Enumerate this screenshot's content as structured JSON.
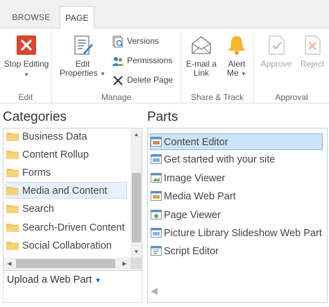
{
  "tabs": {
    "browse": "BROWSE",
    "page": "PAGE"
  },
  "ribbon": {
    "edit_group": {
      "label": "Edit",
      "stop_editing": "Stop Editing"
    },
    "manage_group": {
      "label": "Manage",
      "edit_properties_line1": "Edit",
      "edit_properties_line2": "Properties",
      "versions": "Versions",
      "permissions": "Permissions",
      "delete_page": "Delete Page"
    },
    "share_group": {
      "label": "Share & Track",
      "email_line1": "E-mail a",
      "email_line2": "Link",
      "alert_line1": "Alert",
      "alert_line2": "Me"
    },
    "approval_group": {
      "label": "Approval",
      "approve": "Approve",
      "reject": "Reject"
    }
  },
  "categories": {
    "heading": "Categories",
    "items": [
      "Business Data",
      "Content Rollup",
      "Forms",
      "Media and Content",
      "Search",
      "Search-Driven Content",
      "Social Collaboration"
    ],
    "selected_index": 3,
    "upload_label": "Upload a Web Part"
  },
  "parts": {
    "heading": "Parts",
    "items": [
      {
        "label": "Content Editor",
        "icon": "content-editor-icon"
      },
      {
        "label": "Get started with your site",
        "icon": "get-started-icon"
      },
      {
        "label": "Image Viewer",
        "icon": "image-viewer-icon"
      },
      {
        "label": "Media Web Part",
        "icon": "media-web-part-icon"
      },
      {
        "label": "Page Viewer",
        "icon": "page-viewer-icon"
      },
      {
        "label": "Picture Library Slideshow Web Part",
        "icon": "picture-library-icon"
      },
      {
        "label": "Script Editor",
        "icon": "script-editor-icon"
      }
    ],
    "selected_index": 0
  },
  "colors": {
    "stop_red": "#d9452e",
    "accent_blue": "#0072c6",
    "selection_bg": "#cde3f7",
    "folder_yellow": "#f2c55c"
  }
}
